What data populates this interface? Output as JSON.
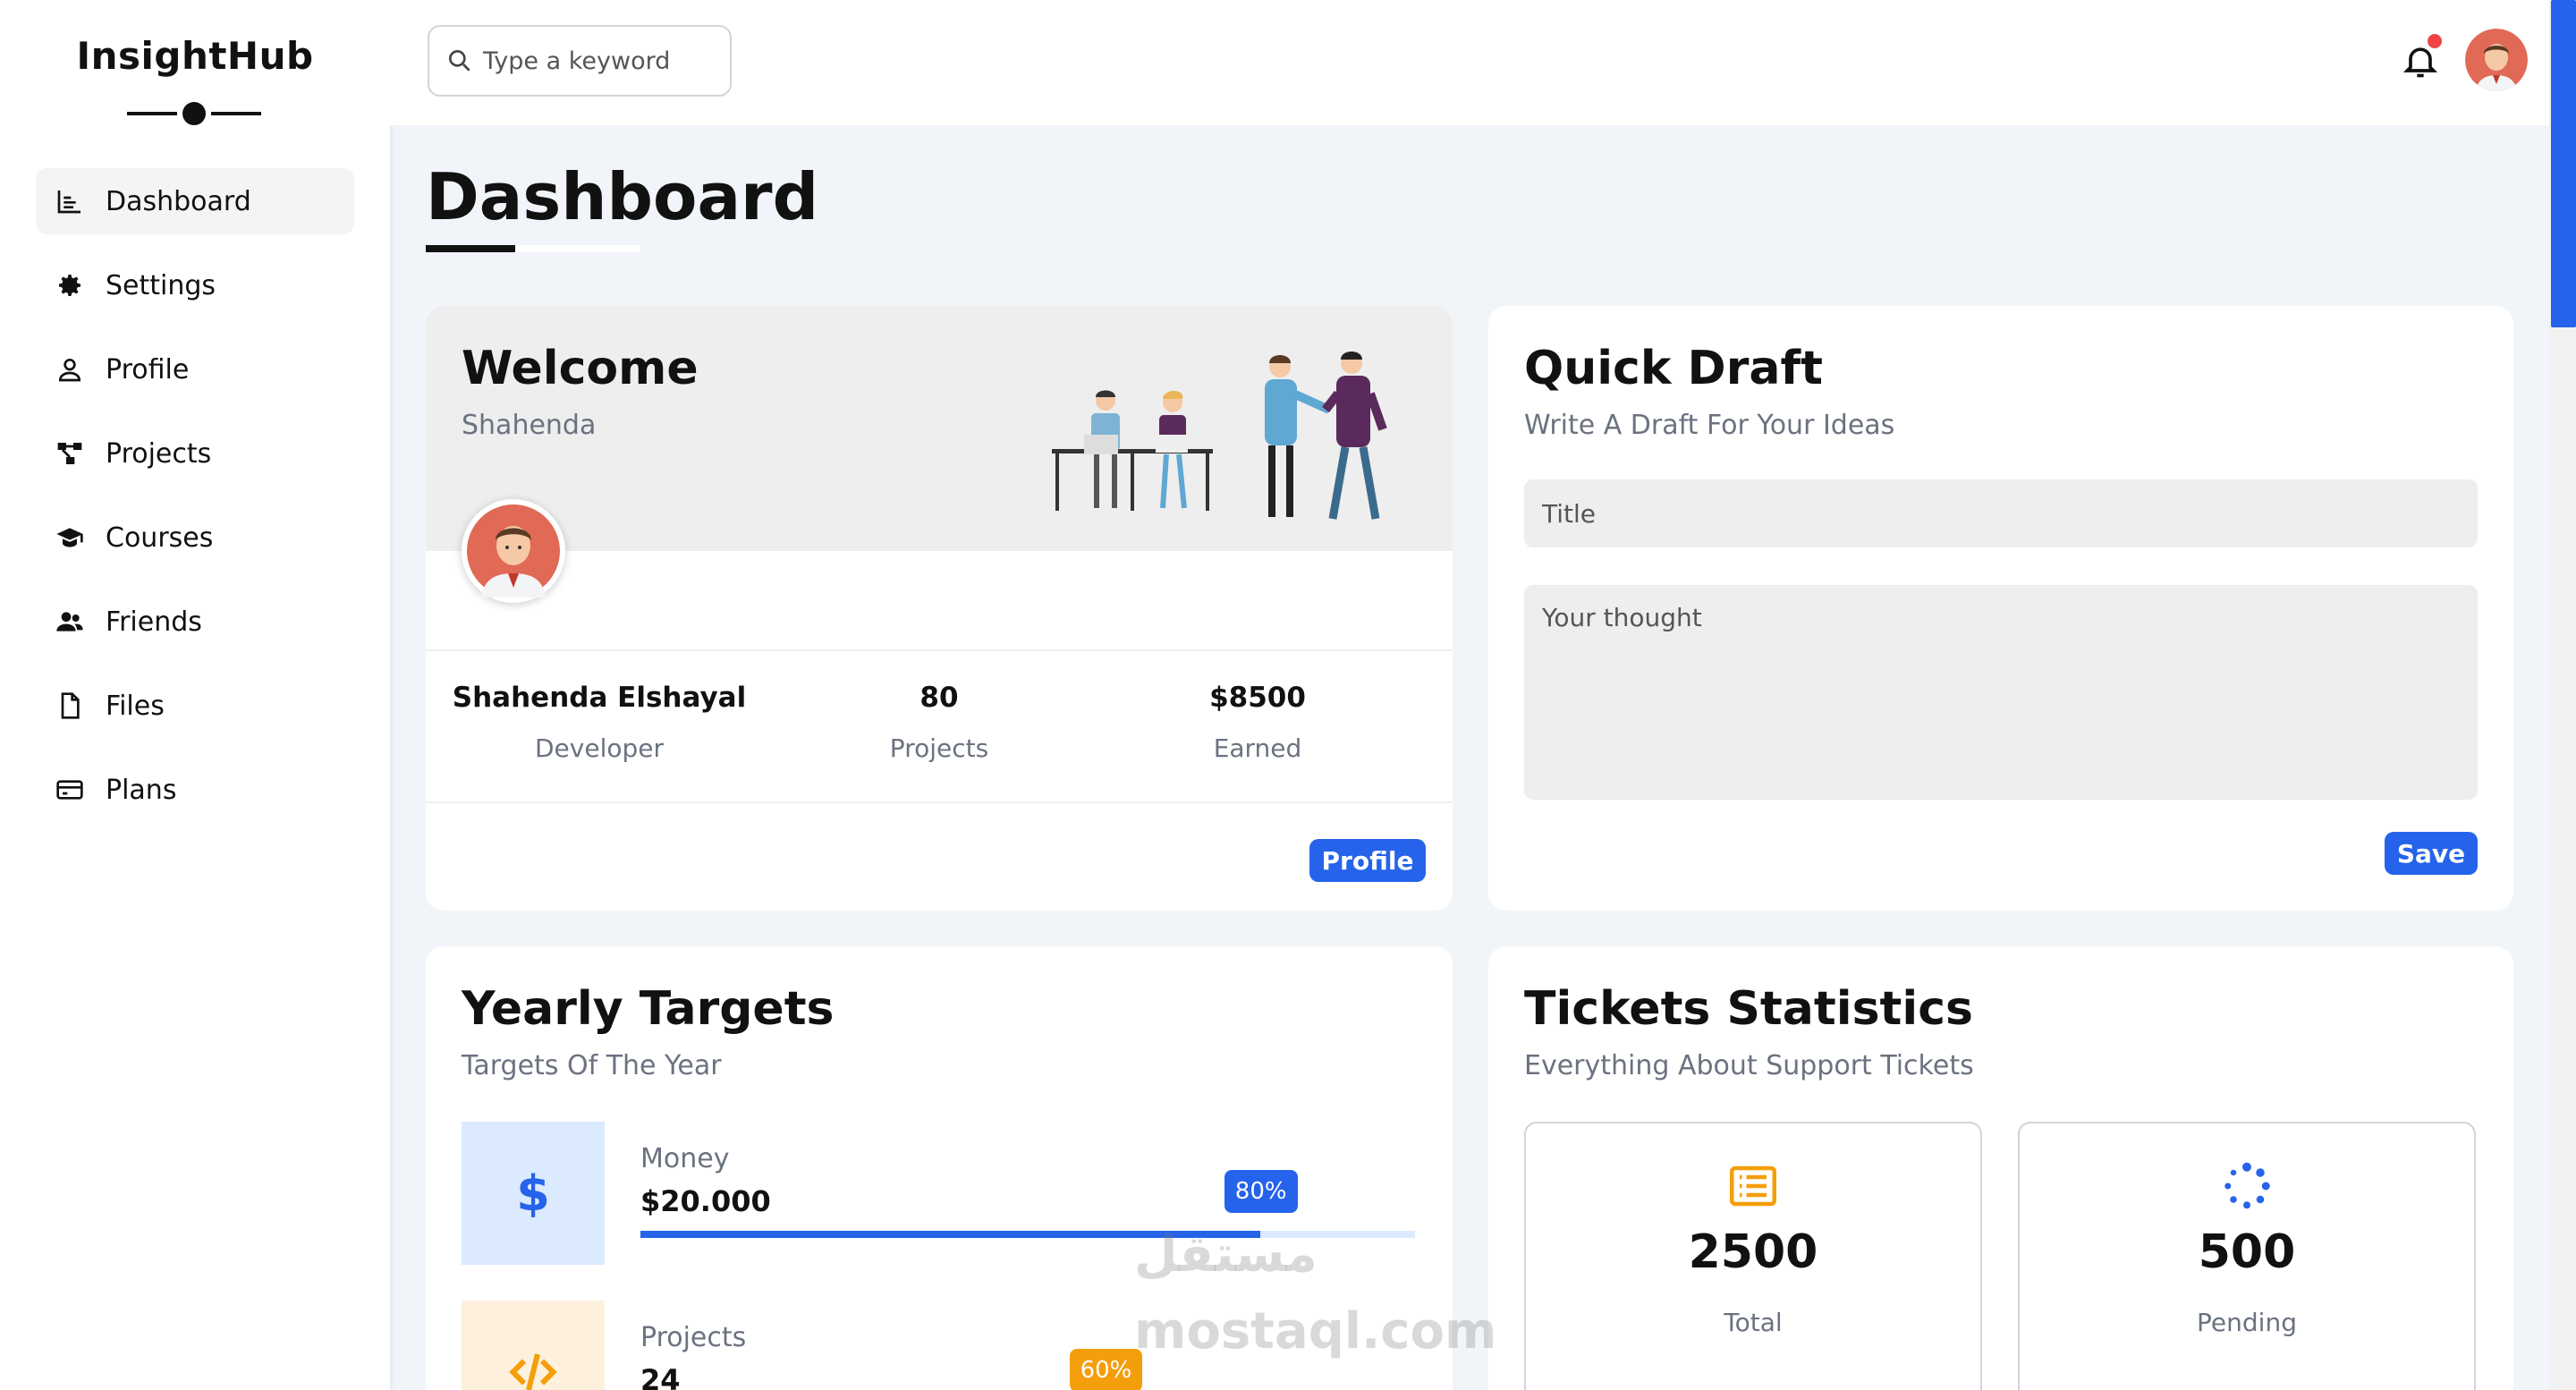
{
  "brand": {
    "name": "InsightHub"
  },
  "sidebar": {
    "items": [
      {
        "label": "Dashboard",
        "icon": "chart-icon",
        "active": true
      },
      {
        "label": "Settings",
        "icon": "gear-icon"
      },
      {
        "label": "Profile",
        "icon": "user-icon"
      },
      {
        "label": "Projects",
        "icon": "diagram-icon"
      },
      {
        "label": "Courses",
        "icon": "graduation-cap-icon"
      },
      {
        "label": "Friends",
        "icon": "users-icon"
      },
      {
        "label": "Files",
        "icon": "file-icon"
      },
      {
        "label": "Plans",
        "icon": "credit-card-icon"
      }
    ]
  },
  "topbar": {
    "search_placeholder": "Type a keyword"
  },
  "page": {
    "title": "Dashboard"
  },
  "welcome": {
    "title": "Welcome",
    "name": "Shahenda",
    "stats": [
      {
        "value": "Shahenda Elshayal",
        "label": "Developer"
      },
      {
        "value": "80",
        "label": "Projects"
      },
      {
        "value": "$8500",
        "label": "Earned"
      }
    ],
    "button": "Profile"
  },
  "draft": {
    "title": "Quick Draft",
    "subtitle": "Write A Draft For Your Ideas",
    "title_placeholder": "Title",
    "body_placeholder": "Your thought",
    "button": "Save"
  },
  "targets": {
    "title": "Yearly Targets",
    "subtitle": "Targets Of The Year",
    "items": [
      {
        "name": "Money",
        "value": "$20.000",
        "percent": 80,
        "percent_label": "80%",
        "icon": "dollar-icon",
        "color": "#2563eb",
        "tile_bg": "#dbeafe",
        "track_bg": "#dbeafe"
      },
      {
        "name": "Projects",
        "value": "24",
        "percent": 60,
        "percent_label": "60%",
        "icon": "code-icon",
        "color": "#f59e0b",
        "tile_bg": "#fdf1dd",
        "track_bg": "#fdf1dd"
      }
    ]
  },
  "tickets": {
    "title": "Tickets Statistics",
    "subtitle": "Everything About Support Tickets",
    "items": [
      {
        "value": "2500",
        "label": "Total",
        "icon": "list-icon",
        "color": "#f59e0b"
      },
      {
        "value": "500",
        "label": "Pending",
        "icon": "spinner-icon",
        "color": "#2563eb"
      }
    ]
  },
  "watermark": {
    "arabic": "مستقل",
    "latin": "mostaql.com"
  },
  "colors": {
    "accent": "#2563eb",
    "background": "#f1f5f9"
  }
}
